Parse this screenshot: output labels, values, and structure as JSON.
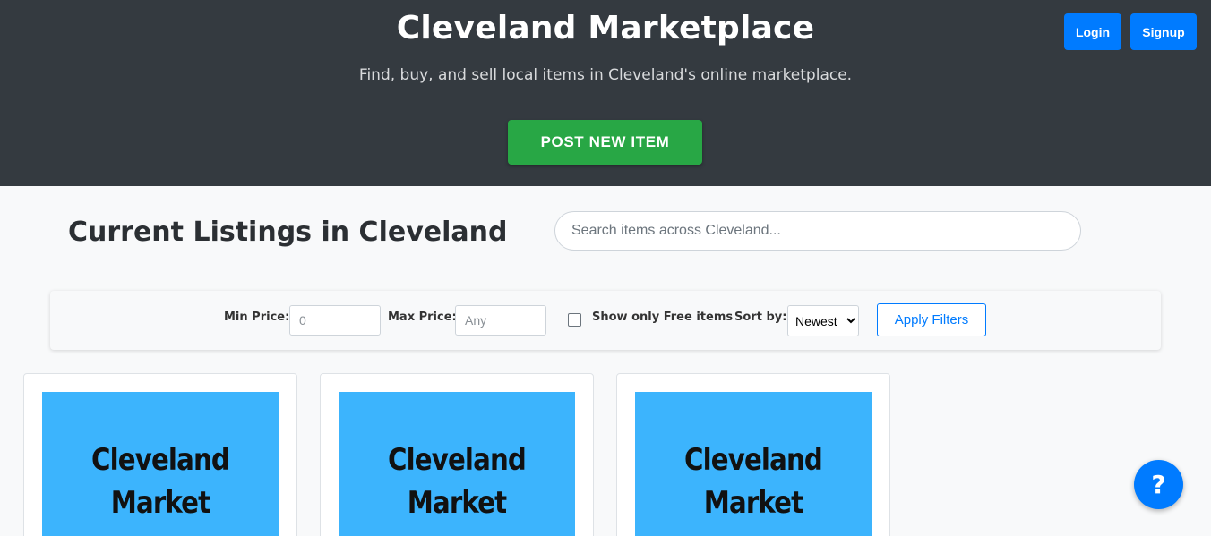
{
  "header": {
    "title": "Cleveland Marketplace",
    "subtitle": "Find, buy, and sell local items in Cleveland's online marketplace.",
    "post_button": "POST NEW ITEM",
    "login_button": "Login",
    "signup_button": "Signup"
  },
  "listings": {
    "title": "Current Listings in Cleveland",
    "search_placeholder": "Search items across Cleveland..."
  },
  "filters": {
    "min_price_label": "Min Price:",
    "min_price_placeholder": "0",
    "max_price_label": "Max Price:",
    "max_price_placeholder": "Any",
    "free_only_label": "Show only Free items",
    "free_only_checked": false,
    "sort_label": "Sort by:",
    "sort_value": "Newest",
    "apply_button": "Apply Filters"
  },
  "cards": [
    {
      "image_line1": "Cleveland",
      "image_line2": "Market"
    },
    {
      "image_line1": "Cleveland",
      "image_line2": "Market"
    },
    {
      "image_line1": "Cleveland",
      "image_line2": "Market"
    }
  ],
  "help_button": "?",
  "colors": {
    "header_bg": "#343a40",
    "primary": "#007bff",
    "success": "#28a745",
    "card_image_bg": "#3cb4fd"
  }
}
